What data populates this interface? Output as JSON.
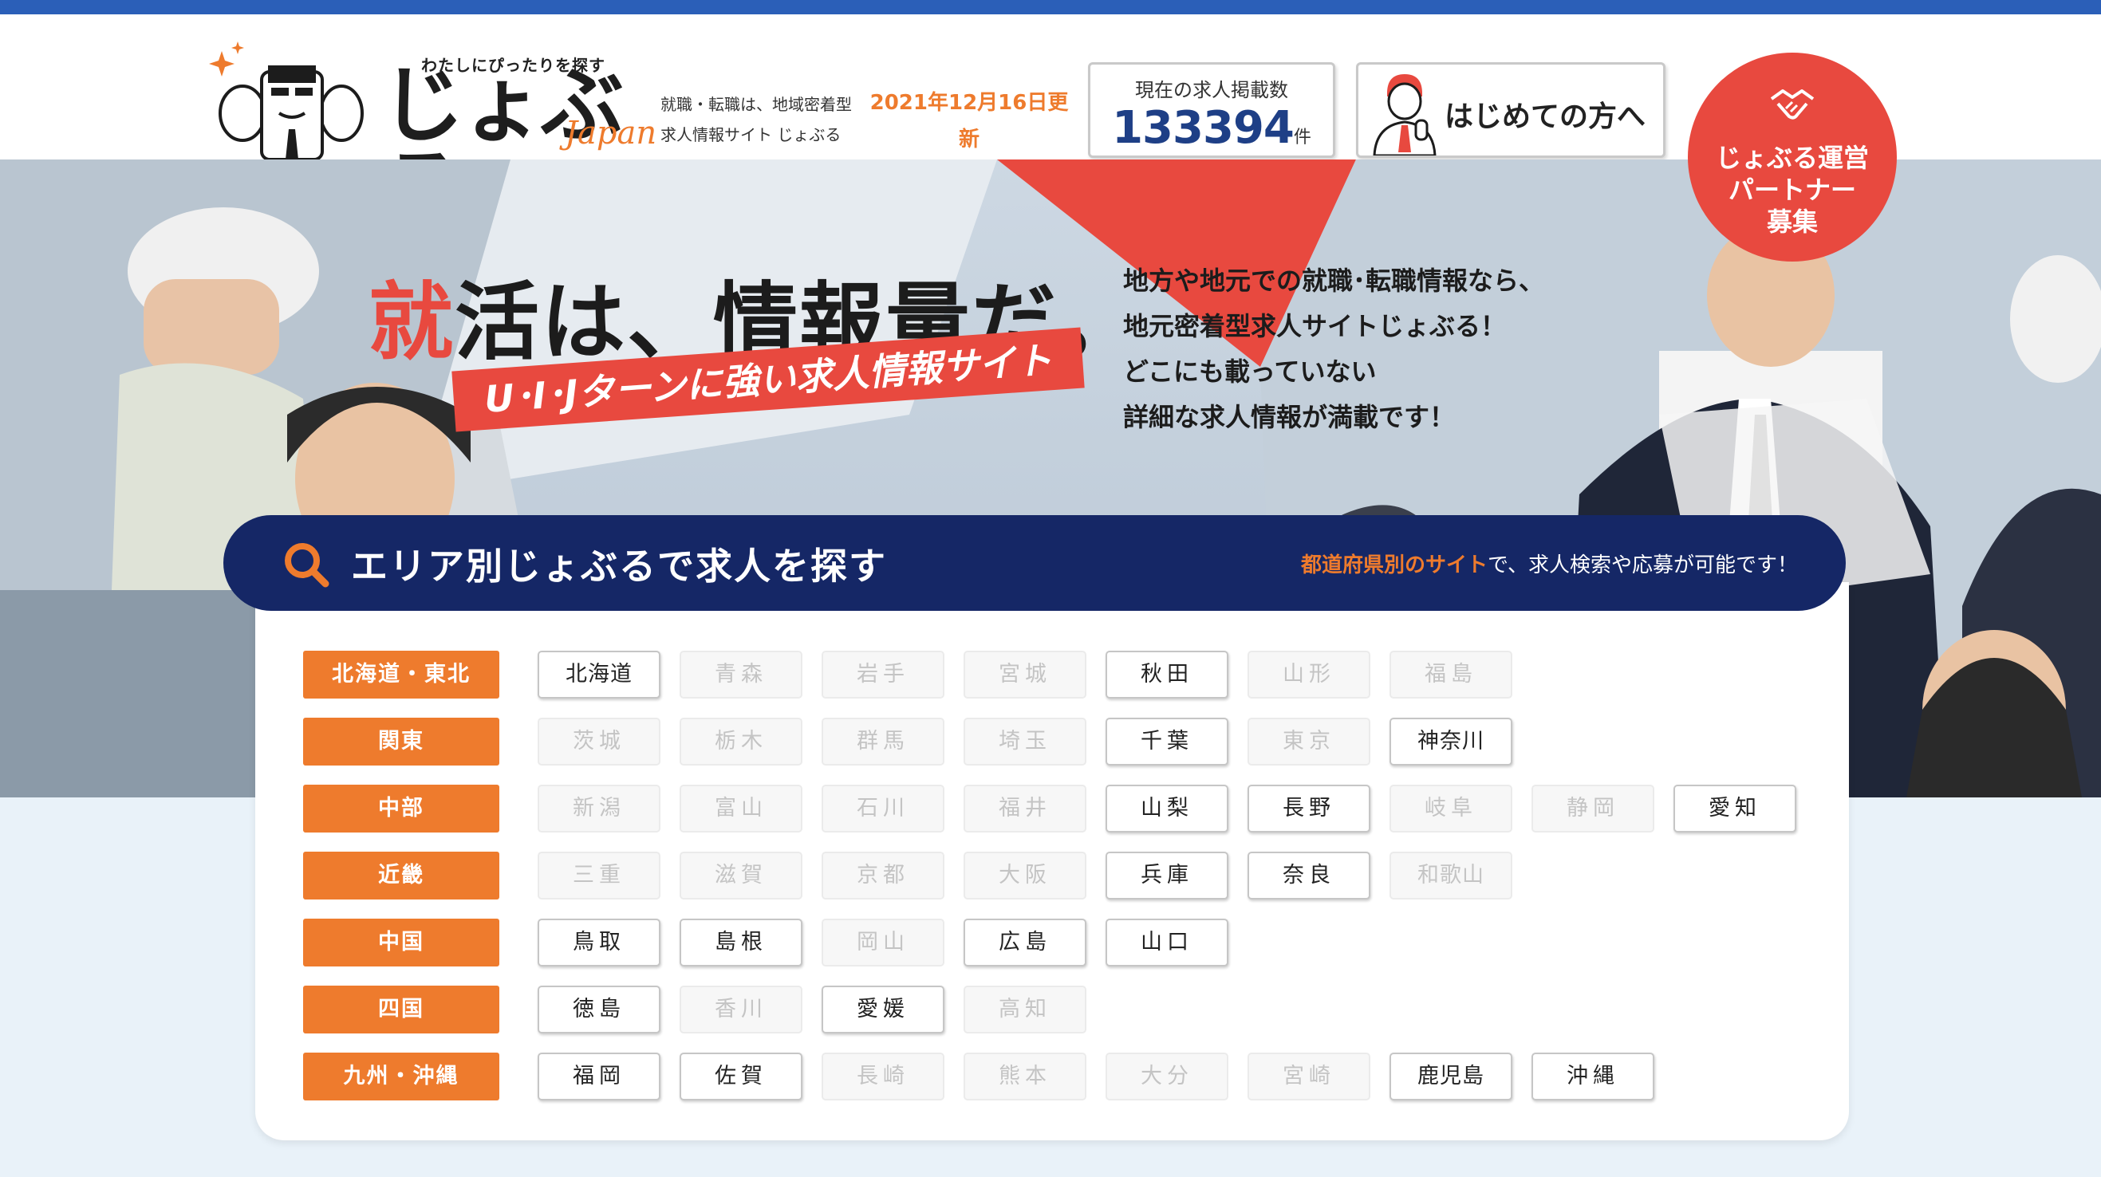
{
  "header": {
    "logo_tagline": "わたしにぴったりを探す",
    "logo_main": "じょぶる",
    "logo_sub": "Japan",
    "tagline_line1": "就職・転職は、地域密着型",
    "tagline_line2": "求人情報サイト じょぶる",
    "update_date": "2021年12月16日更新",
    "job_count_label": "現在の求人掲載数",
    "job_count": "133394",
    "job_count_unit": "件",
    "beginner_label": "はじめての方へ",
    "partner_line1": "じょぶる運営",
    "partner_line2": "パートナー",
    "partner_line3": "募集"
  },
  "hero": {
    "headline_accent": "就",
    "headline_rest": "活は、情報量だ。",
    "banner": "U･I･Jターンに強い求人情報サイト",
    "desc_line1": "地方や地元での就職･転職情報なら、",
    "desc_line2": "地元密着型求人サイトじょぶる！",
    "desc_line3": "どこにも載っていない",
    "desc_line4": "詳細な求人情報が満載です！"
  },
  "search": {
    "title": "エリア別じょぶるで求人を探す",
    "note_highlight": "都道府県別のサイト",
    "note_rest": "で、求人検索や応募が可能です！"
  },
  "regions": [
    {
      "name": "北海道・東北",
      "prefs": [
        {
          "name": "北海道",
          "active": true
        },
        {
          "name": "青森",
          "active": false
        },
        {
          "name": "岩手",
          "active": false
        },
        {
          "name": "宮城",
          "active": false
        },
        {
          "name": "秋田",
          "active": true
        },
        {
          "name": "山形",
          "active": false
        },
        {
          "name": "福島",
          "active": false
        }
      ]
    },
    {
      "name": "関東",
      "prefs": [
        {
          "name": "茨城",
          "active": false
        },
        {
          "name": "栃木",
          "active": false
        },
        {
          "name": "群馬",
          "active": false
        },
        {
          "name": "埼玉",
          "active": false
        },
        {
          "name": "千葉",
          "active": true
        },
        {
          "name": "東京",
          "active": false
        },
        {
          "name": "神奈川",
          "active": true
        }
      ]
    },
    {
      "name": "中部",
      "prefs": [
        {
          "name": "新潟",
          "active": false
        },
        {
          "name": "富山",
          "active": false
        },
        {
          "name": "石川",
          "active": false
        },
        {
          "name": "福井",
          "active": false
        },
        {
          "name": "山梨",
          "active": true
        },
        {
          "name": "長野",
          "active": true
        },
        {
          "name": "岐阜",
          "active": false
        },
        {
          "name": "静岡",
          "active": false
        },
        {
          "name": "愛知",
          "active": true
        }
      ]
    },
    {
      "name": "近畿",
      "prefs": [
        {
          "name": "三重",
          "active": false
        },
        {
          "name": "滋賀",
          "active": false
        },
        {
          "name": "京都",
          "active": false
        },
        {
          "name": "大阪",
          "active": false
        },
        {
          "name": "兵庫",
          "active": true
        },
        {
          "name": "奈良",
          "active": true
        },
        {
          "name": "和歌山",
          "active": false
        }
      ]
    },
    {
      "name": "中国",
      "prefs": [
        {
          "name": "鳥取",
          "active": true
        },
        {
          "name": "島根",
          "active": true
        },
        {
          "name": "岡山",
          "active": false
        },
        {
          "name": "広島",
          "active": true
        },
        {
          "name": "山口",
          "active": true
        }
      ]
    },
    {
      "name": "四国",
      "prefs": [
        {
          "name": "徳島",
          "active": true
        },
        {
          "name": "香川",
          "active": false
        },
        {
          "name": "愛媛",
          "active": true
        },
        {
          "name": "高知",
          "active": false
        }
      ]
    },
    {
      "name": "九州・沖縄",
      "prefs": [
        {
          "name": "福岡",
          "active": true
        },
        {
          "name": "佐賀",
          "active": true
        },
        {
          "name": "長崎",
          "active": false
        },
        {
          "name": "熊本",
          "active": false
        },
        {
          "name": "大分",
          "active": false
        },
        {
          "name": "宮崎",
          "active": false
        },
        {
          "name": "鹿児島",
          "active": true
        },
        {
          "name": "沖縄",
          "active": true
        }
      ]
    }
  ],
  "colors": {
    "top_bar": "#2b5fb8",
    "navy": "#152766",
    "orange": "#ee7b2d",
    "red": "#e8493f",
    "count_blue": "#1e3f86"
  },
  "icons": [
    "mascot-icon",
    "person-icon",
    "handshake-icon",
    "search-icon"
  ]
}
